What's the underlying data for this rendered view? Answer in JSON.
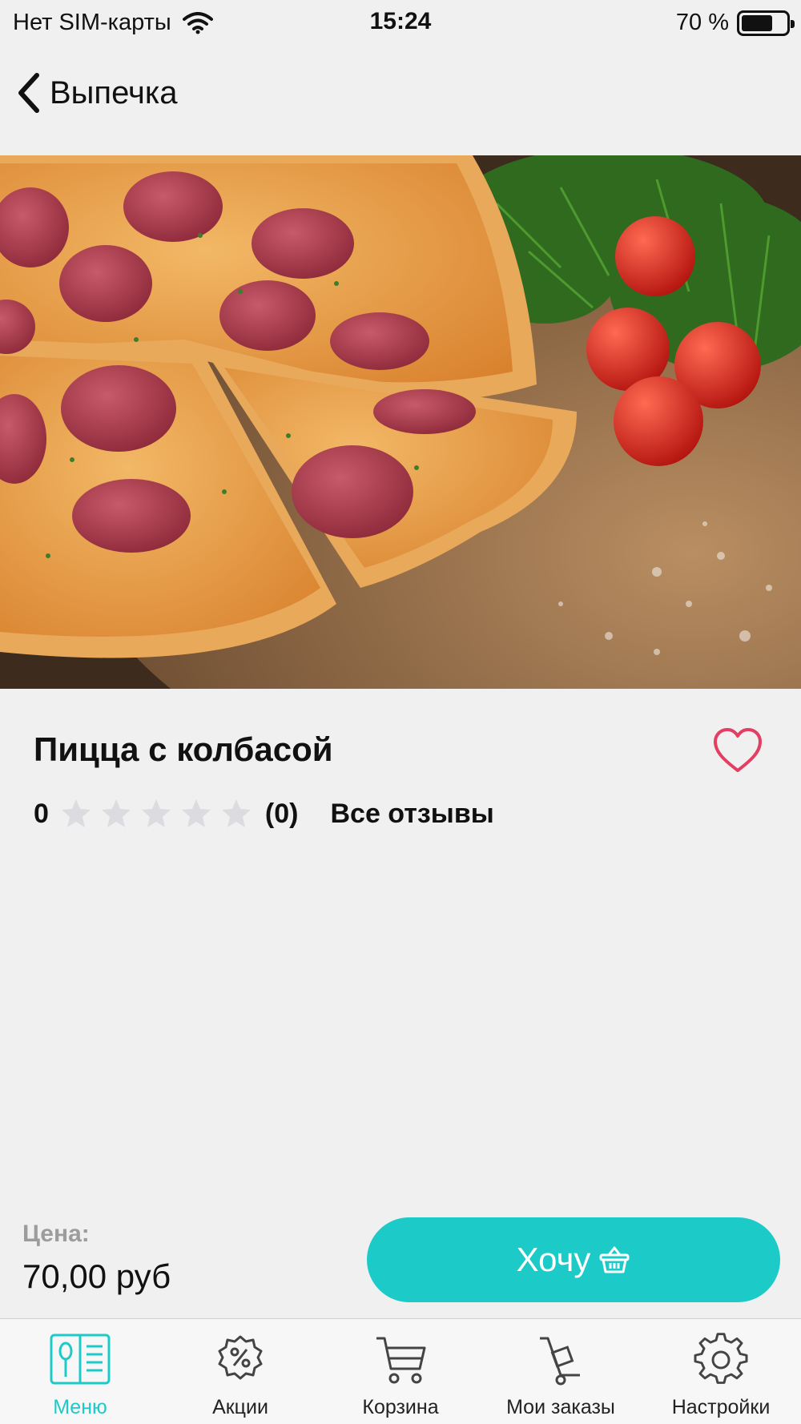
{
  "status_bar": {
    "carrier": "Нет SIM-карты",
    "time": "15:24",
    "battery": "70 %",
    "battery_level": 0.7
  },
  "nav": {
    "back_label": "Выпечка"
  },
  "product": {
    "title": "Пицца с колбасой",
    "rating_value": "0",
    "stars_filled": 0,
    "stars_total": 5,
    "reviews_count": "(0)",
    "all_reviews_label": "Все отзывы",
    "favorite_icon": "heart-outline-icon"
  },
  "purchase": {
    "price_label": "Цена:",
    "price_value": "70,00 руб",
    "cta_label": "Хочу",
    "cta_icon": "basket-icon"
  },
  "tabs": [
    {
      "label": "Меню",
      "icon": "menu-book-icon",
      "active": true
    },
    {
      "label": "Акции",
      "icon": "discount-gear-icon",
      "active": false
    },
    {
      "label": "Корзина",
      "icon": "cart-icon",
      "active": false
    },
    {
      "label": "Мои заказы",
      "icon": "delivery-cart-icon",
      "active": false
    },
    {
      "label": "Настройки",
      "icon": "gear-icon",
      "active": false
    }
  ],
  "colors": {
    "accent": "#1ccbc8",
    "heart": "#e23f62",
    "star_empty": "#dcdce0",
    "background": "#f0f0f1",
    "muted_text": "#9c9c9c"
  }
}
